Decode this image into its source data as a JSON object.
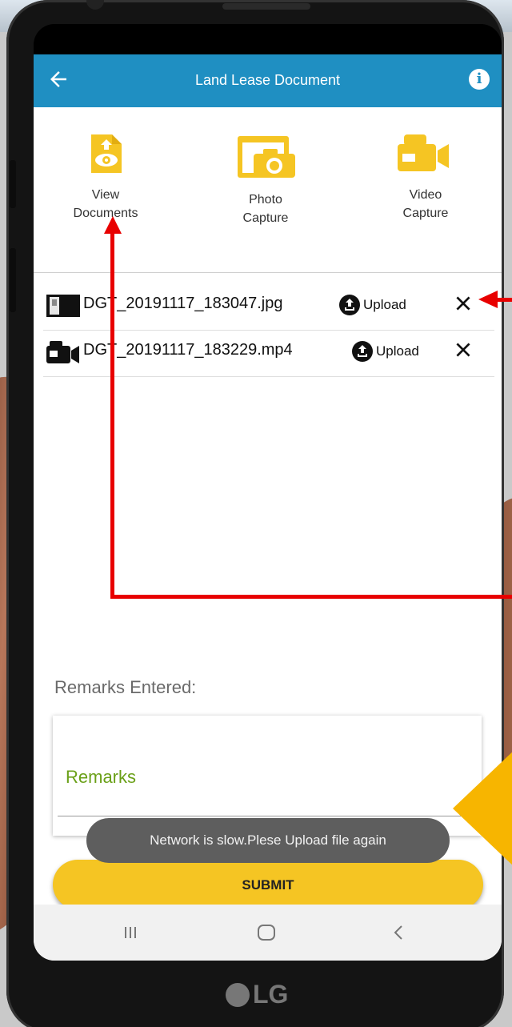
{
  "app": {
    "title": "Land Lease Document",
    "accent_color": "#1f8fc2",
    "icon_color": "#f5c523"
  },
  "actions": [
    {
      "label": "View\nDocuments",
      "icon": "view-document-icon"
    },
    {
      "label": "Photo\nCapture",
      "icon": "photo-capture-icon"
    },
    {
      "label": "Video\nCapture",
      "icon": "video-capture-icon"
    }
  ],
  "files": [
    {
      "name": "DGT_20191117_183047.jpg",
      "type_icon": "image-file-icon",
      "upload_label": "Upload",
      "remove_icon": "close-icon"
    },
    {
      "name": "DGT_20191117_183229.mp4",
      "type_icon": "video-file-icon",
      "upload_label": "Upload",
      "remove_icon": "close-icon"
    }
  ],
  "remarks": {
    "label": "Remarks Entered:",
    "placeholder": "Remarks"
  },
  "toast": "Network is slow.Plese Upload file again",
  "submit_label": "SUBMIT",
  "device_brand": "LG"
}
